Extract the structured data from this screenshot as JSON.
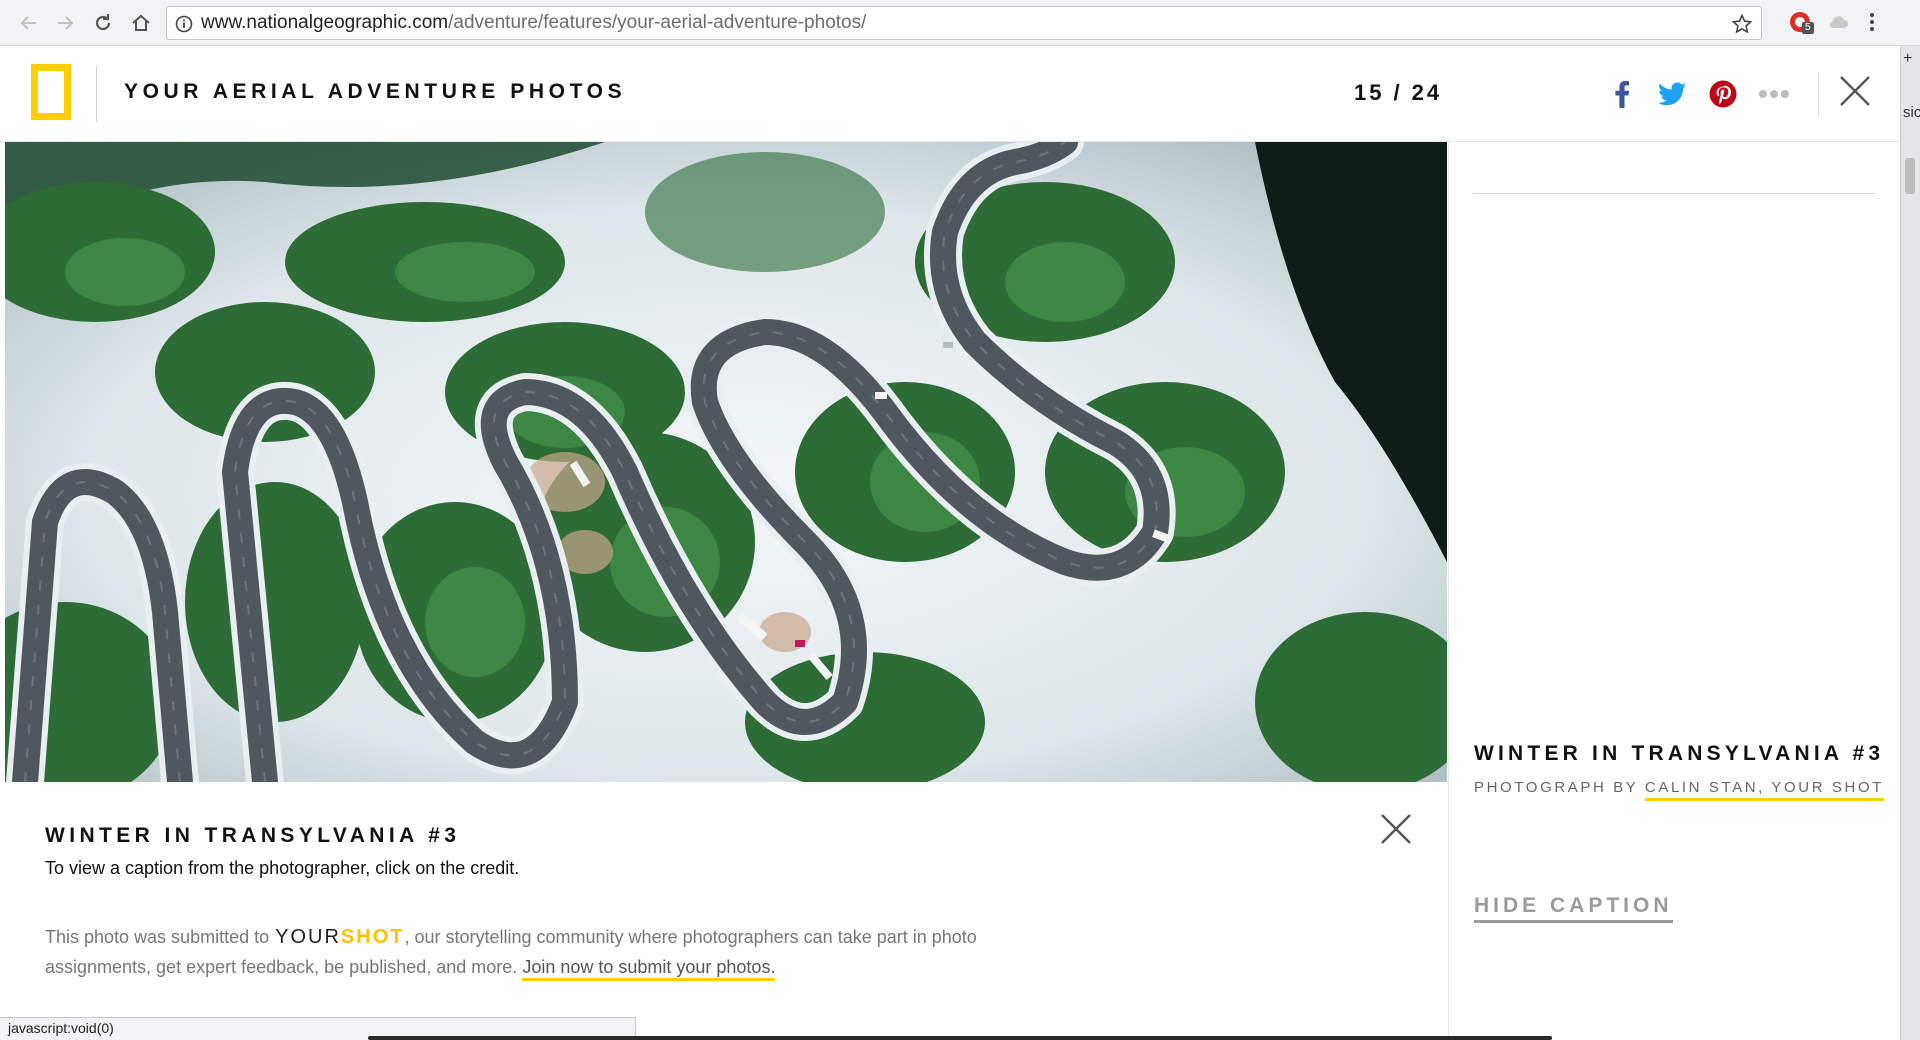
{
  "browser": {
    "url_host": "www.nationalgeographic.com",
    "url_path": "/adventure/features/your-aerial-adventure-photos/",
    "extension_badge": "5",
    "status_text": "javascript:void(0)",
    "side_window_text": "sic",
    "side_window_plus": "+"
  },
  "header": {
    "title": "YOUR AERIAL ADVENTURE PHOTOS",
    "counter_current": "15",
    "counter_separator": "/",
    "counter_total": "24",
    "share_icons": [
      "facebook-icon",
      "twitter-icon",
      "pinterest-icon",
      "more-icon"
    ]
  },
  "photo": {
    "subject": "Aerial view of a winding road through a snowy forest"
  },
  "side_panel": {
    "title": "WINTER IN TRANSYLVANIA #3",
    "credit_prefix": "PHOTOGRAPH BY",
    "credit_name": "CALIN STAN, YOUR SHOT",
    "hide_caption": "HIDE CAPTION"
  },
  "caption": {
    "title": "WINTER IN TRANSYLVANIA #3",
    "instruction": "To view a caption from the photographer, click on the credit.",
    "submission_prefix": "This photo was submitted to",
    "yourshot_your": "YOUR",
    "yourshot_shot": "SHOT",
    "submission_middle": ", our storytelling community where photographers can take part in photo assignments, get expert feedback, be published, and more.",
    "join_link": "Join now to submit your photos."
  },
  "colors": {
    "brand_yellow": "#ffcd00",
    "facebook": "#3b5998",
    "twitter": "#1da1f2",
    "pinterest": "#bd081c"
  }
}
